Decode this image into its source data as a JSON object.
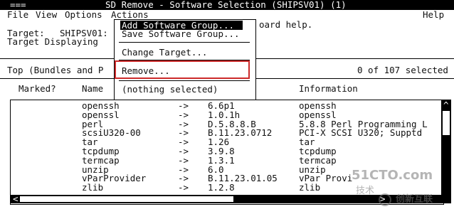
{
  "window": {
    "wm_label": "===",
    "title": "SD Remove - Software Selection (SHIPSV01) (1)"
  },
  "menu": {
    "file": "File",
    "view": "View",
    "options": "Options",
    "actions": "Actions",
    "help": "Help"
  },
  "hint": {
    "text_right": "oard help."
  },
  "info": {
    "target_label": "Target:",
    "target_value": "SHIPSV01:",
    "target_displaying": "Target Displaying"
  },
  "context": {
    "path": "Top (Bundles and P",
    "count": "0 of 107 selected"
  },
  "columns": {
    "marked": "Marked?",
    "name": "Name",
    "information": "Information"
  },
  "actions_menu": {
    "items": [
      {
        "label": "Add Software Group...",
        "selected": true
      },
      {
        "label": "Save Software Group..."
      },
      {
        "label": "Change Target..."
      },
      {
        "label": "Remove..."
      },
      {
        "label": "(nothing selected)"
      }
    ]
  },
  "rows": [
    {
      "name": "openssh",
      "arrow": "->",
      "revision": "6.6p1",
      "info": "openssh"
    },
    {
      "name": "openssl",
      "arrow": "->",
      "revision": "1.0.1h",
      "info": "openssl"
    },
    {
      "name": "perl",
      "arrow": "->",
      "revision": "D.5.8.8.B",
      "info": "5.8.8 Perl Programming L"
    },
    {
      "name": "scsiU320-00",
      "arrow": "->",
      "revision": "B.11.23.0712",
      "info": "PCI-X SCSI U320; Supptd"
    },
    {
      "name": "tar",
      "arrow": "->",
      "revision": "1.26",
      "info": "tar"
    },
    {
      "name": "tcpdump",
      "arrow": "->",
      "revision": "3.9.8",
      "info": "tcpdump"
    },
    {
      "name": "termcap",
      "arrow": "->",
      "revision": "1.3.1",
      "info": "termcap"
    },
    {
      "name": "unzip",
      "arrow": "->",
      "revision": "6.0",
      "info": "unzip"
    },
    {
      "name": "vParProvider",
      "arrow": "->",
      "revision": "B.11.23.01.05",
      "info": "vPar Provi"
    },
    {
      "name": "zlib",
      "arrow": "->",
      "revision": "1.2.8",
      "info": "zlib"
    }
  ],
  "scroll": {
    "left_arrow": "<",
    "right_arrow": ">",
    "up_arrow": "^"
  },
  "watermarks": {
    "site": "51CTO.com",
    "sub": "技术",
    "brand": "创新互联"
  }
}
